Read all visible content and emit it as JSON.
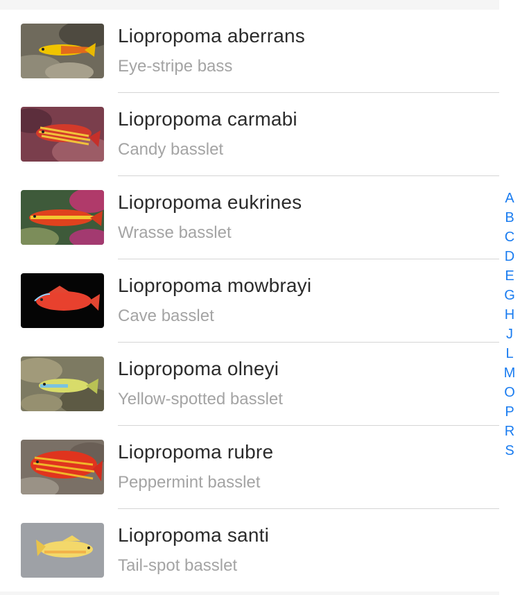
{
  "species": [
    {
      "scientific": "Liopropoma aberrans",
      "common": "Eye-stripe bass",
      "photo": "fish-aberrans"
    },
    {
      "scientific": "Liopropoma carmabi",
      "common": "Candy basslet",
      "photo": "fish-carmabi"
    },
    {
      "scientific": "Liopropoma eukrines",
      "common": "Wrasse basslet",
      "photo": "fish-eukrines"
    },
    {
      "scientific": "Liopropoma mowbrayi",
      "common": "Cave basslet",
      "photo": "fish-mowbrayi"
    },
    {
      "scientific": "Liopropoma olneyi",
      "common": "Yellow-spotted basslet",
      "photo": "fish-olneyi"
    },
    {
      "scientific": "Liopropoma rubre",
      "common": "Peppermint basslet",
      "photo": "fish-rubre"
    },
    {
      "scientific": "Liopropoma santi",
      "common": "Tail-spot basslet",
      "photo": "fish-santi"
    }
  ],
  "index_letters": [
    "A",
    "B",
    "C",
    "D",
    "E",
    "G",
    "H",
    "J",
    "L",
    "M",
    "O",
    "P",
    "R",
    "S"
  ],
  "colors": {
    "index_accent": "#1a7cf0",
    "title": "#2b2b2b",
    "subtitle": "#a4a4a4"
  }
}
